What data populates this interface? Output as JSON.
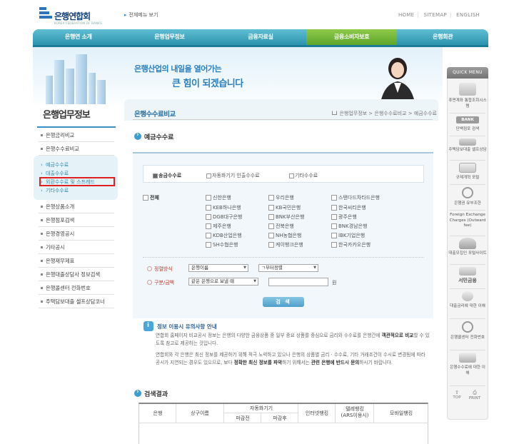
{
  "colors": {
    "gnb_blue": "#2c93ad",
    "gnb_green": "#5da52a",
    "accent": "#2a7fc0",
    "label_red": "#c23b2d",
    "highlight_box": "#e02020"
  },
  "header": {
    "logo_text": "은행연합회",
    "logo_sub": "KOREA FEDERATION OF BANKS",
    "all_menu": "전체메뉴 보기",
    "util_links": [
      "HOME",
      "SITEMAP",
      "ENGLISH"
    ]
  },
  "gnb": [
    "은행연 소개",
    "은행업무정보",
    "금융자료실",
    "금융소비자보호",
    "은행회관"
  ],
  "banner": {
    "line1": "은행산업의 내일을 열어가는",
    "line2": "큰 힘이 되겠습니다"
  },
  "sidebar": {
    "title": "은행업무정보",
    "items_top": [
      "은행금리비교",
      "은행수수료비교"
    ],
    "sub_items": [
      "예금수수료",
      "대출수수료",
      "외환수수료 및 스프레드",
      "기타수수료"
    ],
    "items_bottom": [
      "은행상품소개",
      "은행점포검색",
      "은행경영공시",
      "기타공시",
      "은행재무제표",
      "은행대출상담사 정보검색",
      "은행콜센터 전화번호",
      "주택담보대출 셀프상담코너"
    ]
  },
  "content": {
    "page_title": "은행수수료비교",
    "breadcrumb": "은행업무정보 > 은행수수료비교 > 예금수수료",
    "section_title": "예금수수료",
    "tabs": [
      "송금수수료",
      "자동화기기 인출수수료",
      "기타수수료"
    ],
    "check_all": "전체",
    "banks": [
      [
        "신한은행",
        "우리은행",
        "스탠다드차타드은행"
      ],
      [
        "KEB하나은행",
        "KB국민은행",
        "한국씨티은행"
      ],
      [
        "DGB대구은행",
        "BNK부산은행",
        "광주은행"
      ],
      [
        "제주은행",
        "전북은행",
        "BNK경남은행"
      ],
      [
        "KDB산업은행",
        "NH농협은행",
        "IBK기업은행"
      ],
      [
        "SH수협은행",
        "케이뱅크은행",
        "한국카카오은행"
      ]
    ],
    "sort_label": "정렬방식",
    "sort_select1": "은행이름",
    "sort_select2": "ㄱ부터정렬",
    "type_label": "구분/금액",
    "type_select": "같은 은행으로 보낼 때",
    "won_label": "원",
    "search_button": "검 색",
    "notice_title": "정보 이용시 유의사항 안내",
    "notice_p1_a": "연합회 홈페이지 비교공시 정보는 은행의 다양한 금융상품 중 일부 중요 상품를 중심으로 금리와 수수료를 은행간에 ",
    "notice_p1_b": "객관적으로 비교",
    "notice_p1_c": "할 수 있도록 참고로 제공하는 것입니다.",
    "notice_p2_a": "연합회와 각 은행은 최신 정보를 제공하기 위해 적극 노력하고 있으나 은행의 상품별 금리 · 수수료, 기타 거래조건이 수시로 변경됨에 따라 공시가 지연되는 경우도 있으므로, 보다 ",
    "notice_p2_b": "정확한 최신 정보를 파악",
    "notice_p2_c": "하기 위해서는 ",
    "notice_p2_d": "관련 은행에 반드시 문의",
    "notice_p2_e": "하시기 바랍니다.",
    "result_title": "검색결과",
    "table_headers": {
      "bank": "은행",
      "product": "상구이름",
      "atm": "자동화기기",
      "atm_before": "마감전",
      "atm_after": "마감후",
      "internet": "인터넷뱅킹",
      "tele": "텔레뱅킹\n(ARS이용시)",
      "mobile": "모바일뱅킹"
    }
  },
  "quick_menu": {
    "title": "QUICK MENU",
    "items": [
      "휴면계좌 통합조회시스템",
      "BANK",
      "단백점포 검색",
      "주택담보대출 셀프상담",
      "규제개혁 포털",
      "은행권 유부조한",
      "Foreign Exchange Charges (Outward fee)",
      "대출모집인 포털사이트",
      "서민금융",
      "대출금리에 대한 이해",
      "은행콜센터 전화번호",
      "은행수수료에 대한 이해"
    ],
    "top": "TOP",
    "print": "PRINT"
  }
}
